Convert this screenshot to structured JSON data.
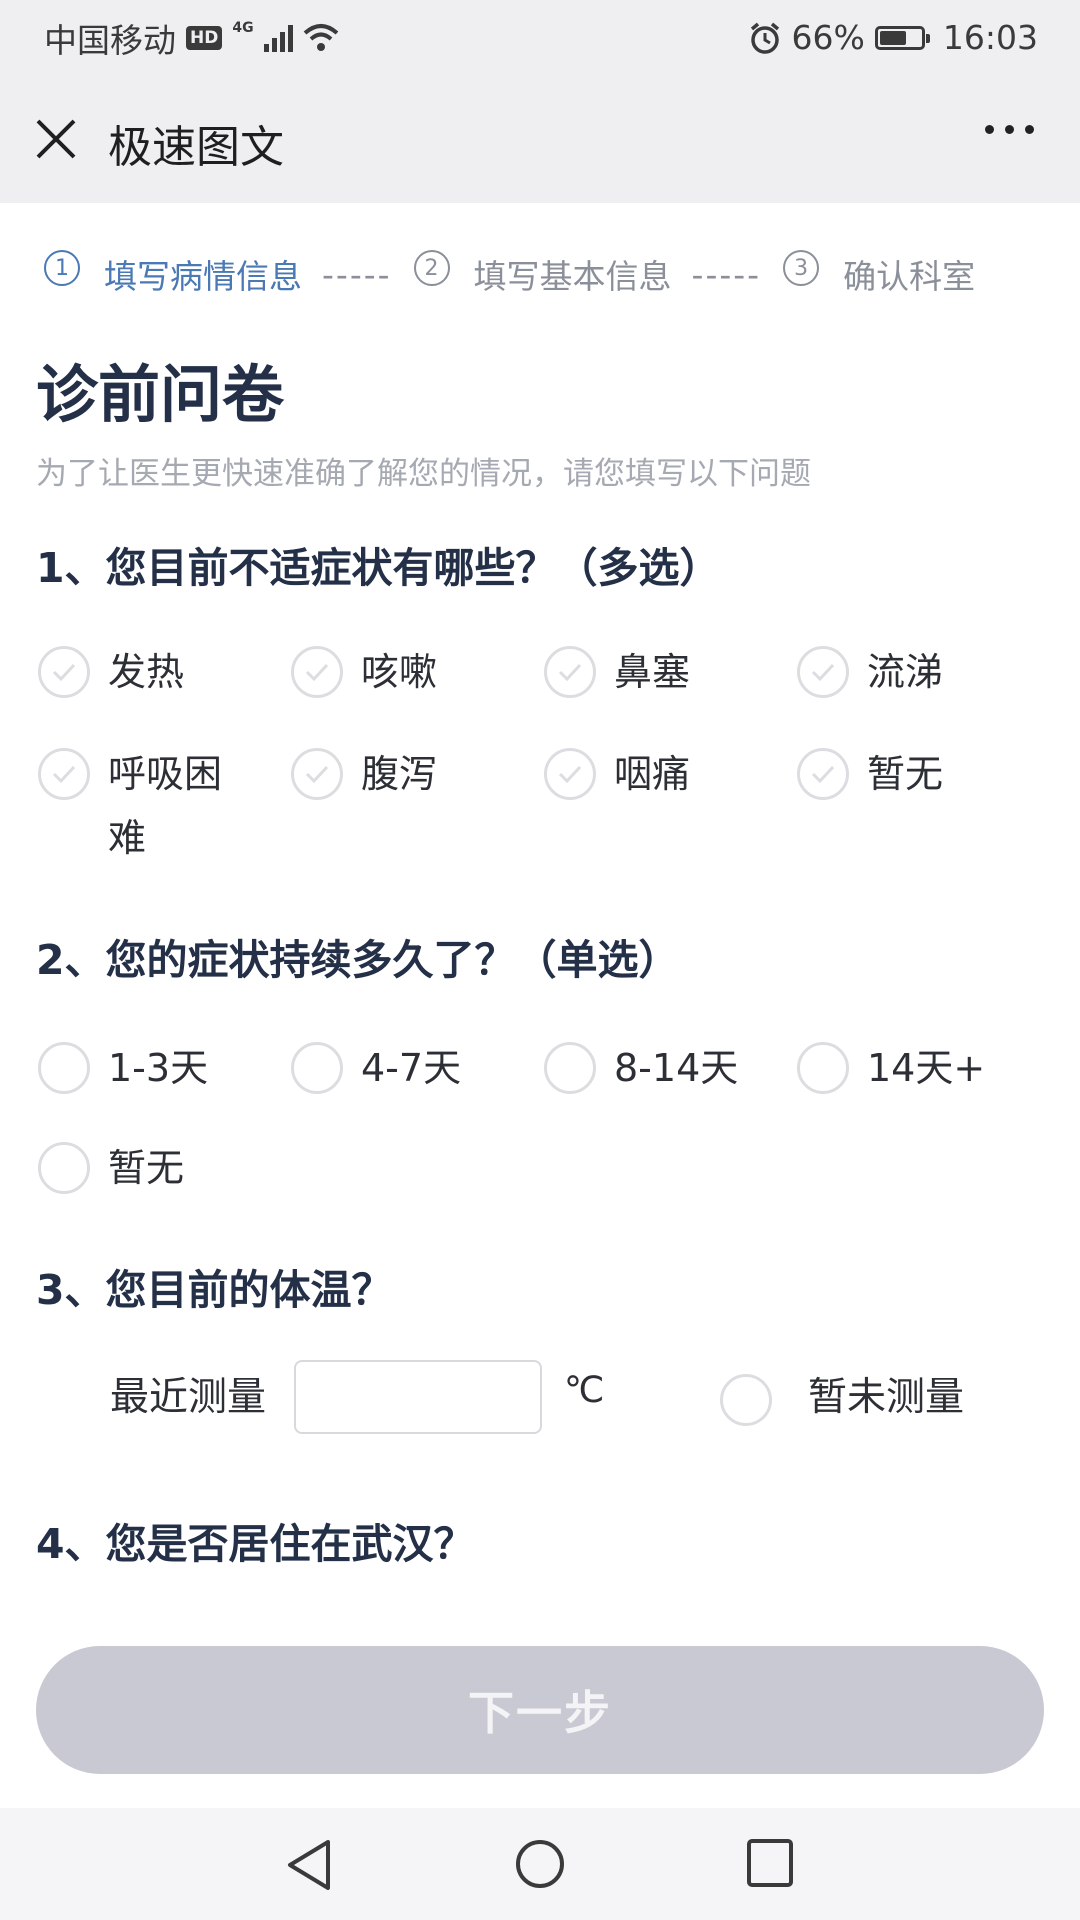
{
  "status_bar": {
    "carrier": "中国移动",
    "hd": "HD",
    "network": "4G",
    "battery": "66%",
    "battery_level": 0.66,
    "time": "16:03"
  },
  "nav": {
    "title": "极速图文"
  },
  "steps": [
    {
      "num": "1",
      "label": "填写病情信息",
      "active": true
    },
    {
      "num": "2",
      "label": "填写基本信息",
      "active": false
    },
    {
      "num": "3",
      "label": "确认科室",
      "active": false
    }
  ],
  "step_separator": "-----",
  "page": {
    "title": "诊前问卷",
    "subtitle": "为了让医生更快速准确了解您的情况，请您填写以下问题"
  },
  "q1": {
    "text": "1、您目前不适症状有哪些？（多选）",
    "options": [
      "发热",
      "咳嗽",
      "鼻塞",
      "流涕",
      "呼吸困难",
      "腹泻",
      "咽痛",
      "暂无"
    ]
  },
  "q2": {
    "text": "2、您的症状持续多久了？（单选）",
    "options": [
      "1-3天",
      "4-7天",
      "8-14天",
      "14天+",
      "暂无"
    ]
  },
  "q3": {
    "text": "3、您目前的体温？",
    "measured_label": "最近测量",
    "input_value": "",
    "unit": "℃",
    "unmeasured_label": "暂未测量"
  },
  "q4": {
    "text": "4、您是否居住在武汉？"
  },
  "next_button": "下一步",
  "colors": {
    "accent": "#4a79b4",
    "heading": "#243047",
    "disabled_button": "#c8c9d2"
  }
}
